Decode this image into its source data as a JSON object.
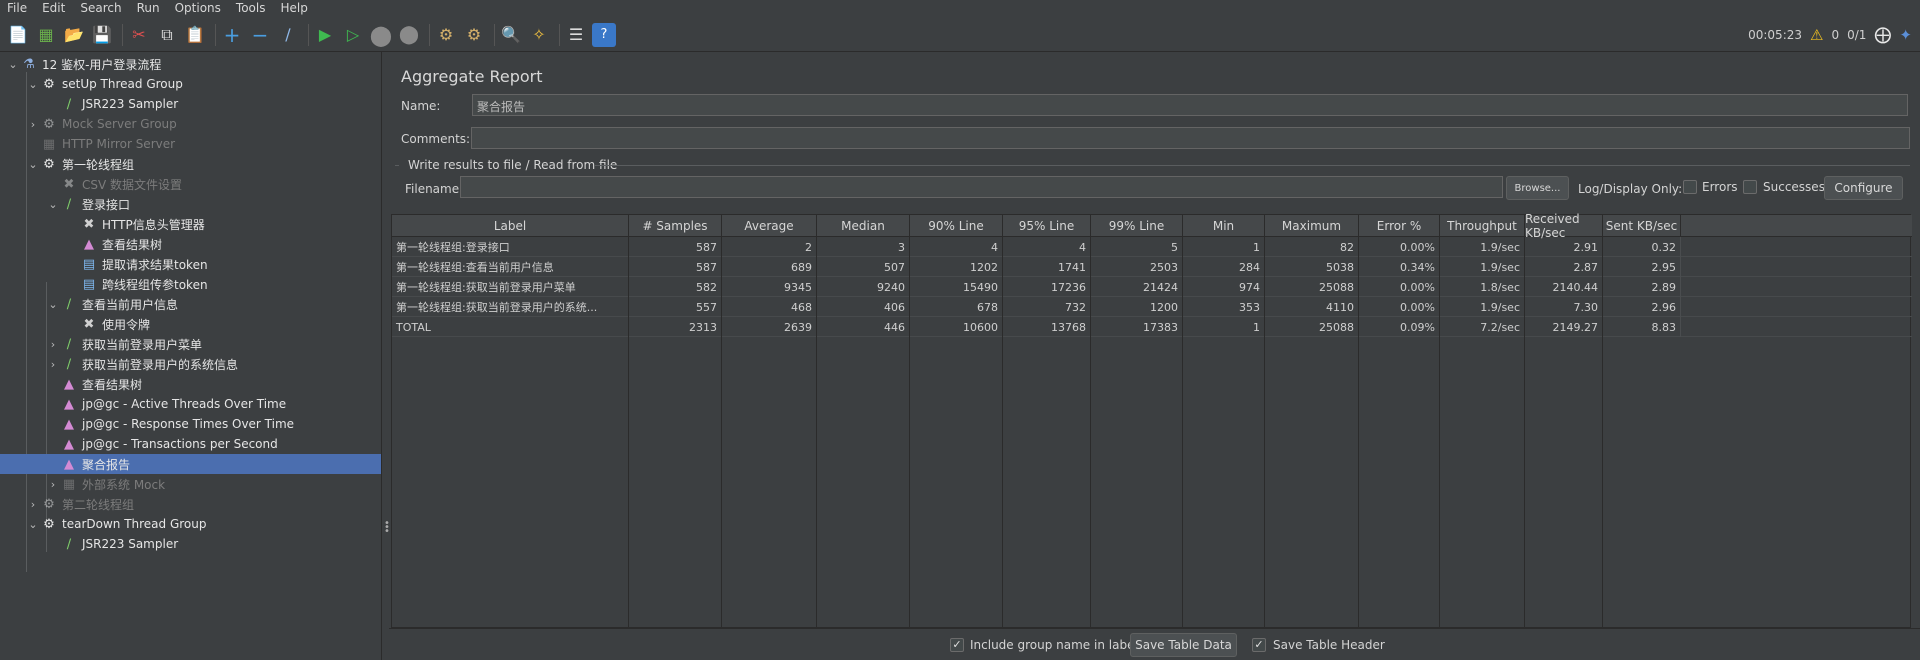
{
  "menu": [
    "File",
    "Edit",
    "Search",
    "Run",
    "Options",
    "Tools",
    "Help"
  ],
  "toolbar": {
    "timer": "00:05:23",
    "warnings": "0",
    "threads": "0/1"
  },
  "tree": [
    {
      "label": "12 鉴权-用户登录流程",
      "icon": "test-plan-icon",
      "disabled": false
    },
    {
      "label": "setUp Thread Group",
      "icon": "gear-icon",
      "disabled": false
    },
    {
      "label": "JSR223 Sampler",
      "icon": "pipette-icon",
      "disabled": false
    },
    {
      "label": "Mock Server Group",
      "icon": "gear-icon",
      "disabled": true
    },
    {
      "label": "HTTP Mirror Server",
      "icon": "server-icon",
      "disabled": true
    },
    {
      "label": "第一轮线程组",
      "icon": "gear-icon",
      "disabled": false
    },
    {
      "label": "CSV 数据文件设置",
      "icon": "wrench-icon",
      "disabled": true
    },
    {
      "label": "登录接口",
      "icon": "pipette-icon",
      "disabled": false
    },
    {
      "label": "HTTP信息头管理器",
      "icon": "wrench-icon",
      "disabled": false
    },
    {
      "label": "查看结果树",
      "icon": "graph-icon",
      "disabled": false
    },
    {
      "label": "提取请求结果token",
      "icon": "extractor-icon",
      "disabled": false
    },
    {
      "label": "跨线程组传参token",
      "icon": "extractor-icon",
      "disabled": false
    },
    {
      "label": "查看当前用户信息",
      "icon": "pipette-icon",
      "disabled": false
    },
    {
      "label": "使用令牌",
      "icon": "wrench-icon",
      "disabled": false
    },
    {
      "label": "获取当前登录用户菜单",
      "icon": "pipette-icon",
      "disabled": false
    },
    {
      "label": "获取当前登录用户的系统信息",
      "icon": "pipette-icon",
      "disabled": false
    },
    {
      "label": "查看结果树",
      "icon": "graph-icon",
      "disabled": false
    },
    {
      "label": "jp@gc - Active Threads Over Time",
      "icon": "graph-icon",
      "disabled": false
    },
    {
      "label": "jp@gc - Response Times Over Time",
      "icon": "graph-icon",
      "disabled": false
    },
    {
      "label": "jp@gc - Transactions per Second",
      "icon": "graph-icon",
      "disabled": false
    },
    {
      "label": "聚合报告",
      "icon": "graph-icon",
      "disabled": false
    },
    {
      "label": "外部系统 Mock",
      "icon": "server-icon",
      "disabled": true
    },
    {
      "label": "第二轮线程组",
      "icon": "gear-icon",
      "disabled": true
    },
    {
      "label": "tearDown Thread Group",
      "icon": "gear-icon",
      "disabled": false
    },
    {
      "label": "JSR223 Sampler",
      "icon": "pipette-icon",
      "disabled": false
    }
  ],
  "panel": {
    "title": "Aggregate Report",
    "name_label": "Name:",
    "name_value": "聚合报告",
    "comments_label": "Comments:",
    "comments_value": "",
    "file_section": "Write results to file / Read from file",
    "filename_label": "Filename",
    "filename_value": "",
    "browse": "Browse...",
    "log_display": "Log/Display Only:",
    "errors": "Errors",
    "successes": "Successes",
    "configure": "Configure"
  },
  "table": {
    "headers": [
      "Label",
      "# Samples",
      "Average",
      "Median",
      "90% Line",
      "95% Line",
      "99% Line",
      "Min",
      "Maximum",
      "Error %",
      "Throughput",
      "Received KB/sec",
      "Sent KB/sec"
    ],
    "rows": [
      [
        "第一轮线程组:登录接口",
        "587",
        "2",
        "3",
        "4",
        "4",
        "5",
        "1",
        "82",
        "0.00%",
        "1.9/sec",
        "2.91",
        "0.32"
      ],
      [
        "第一轮线程组:查看当前用户信息",
        "587",
        "689",
        "507",
        "1202",
        "1741",
        "2503",
        "284",
        "5038",
        "0.34%",
        "1.9/sec",
        "2.87",
        "2.95"
      ],
      [
        "第一轮线程组:获取当前登录用户菜单",
        "582",
        "9345",
        "9240",
        "15490",
        "17236",
        "21424",
        "974",
        "25088",
        "0.00%",
        "1.8/sec",
        "2140.44",
        "2.89"
      ],
      [
        "第一轮线程组:获取当前登录用户的系统...",
        "557",
        "468",
        "406",
        "678",
        "732",
        "1200",
        "353",
        "4110",
        "0.00%",
        "1.9/sec",
        "7.30",
        "2.96"
      ],
      [
        "TOTAL",
        "2313",
        "2639",
        "446",
        "10600",
        "13768",
        "17383",
        "1",
        "25088",
        "0.09%",
        "7.2/sec",
        "2149.27",
        "8.83"
      ]
    ]
  },
  "bottom": {
    "include_group": "Include group name in label?",
    "save_table_data": "Save Table Data",
    "save_table_header": "Save Table Header"
  }
}
